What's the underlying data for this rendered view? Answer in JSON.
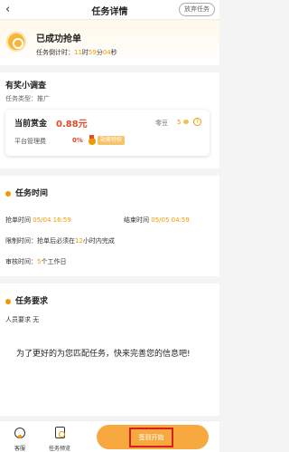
{
  "nav": {
    "back_icon": "‹",
    "title": "任务详情",
    "abandon_label": "放弃任务"
  },
  "header": {
    "status": "已成功抢单",
    "countdown_label": "任务倒计时：",
    "hours": "11",
    "h_unit": "时",
    "minutes": "59",
    "m_unit": "分",
    "seconds": "04",
    "s_unit": "秒"
  },
  "survey": {
    "title": "有奖小调查",
    "type_label": "任务类型：",
    "type_value": "推广",
    "bonus_label": "当前赏金",
    "bonus_value": "0.88元",
    "bean_label": "零豆",
    "bean_value": "5",
    "help_icon": "?",
    "fee_label": "平台管理费",
    "fee_value": "0%",
    "medal_badge": "勋章特权"
  },
  "task_time": {
    "title": "任务时间",
    "grab_label": "抢单时间",
    "grab_value": "05/04 16:59",
    "end_label": "结束时间",
    "end_value": "05/05 04:59",
    "limit_label": "限制时间：",
    "limit_pre": "抢单后必须在",
    "limit_value": "12",
    "limit_post": "小时内完成",
    "review_label": "审核时间：",
    "review_value": "5",
    "review_post": "个工作日"
  },
  "task_req": {
    "title": "任务要求",
    "staff_label": "人员要求",
    "staff_value": "无",
    "note": "为了更好的为您匹配任务，快来完善您的信息吧!"
  },
  "tabbar": {
    "service_label": "客服",
    "preview_label": "任务预览",
    "start_label": "签到开始"
  },
  "colors": {
    "accent": "#f39800",
    "price": "#e24a2b",
    "button": "#f7a940"
  }
}
